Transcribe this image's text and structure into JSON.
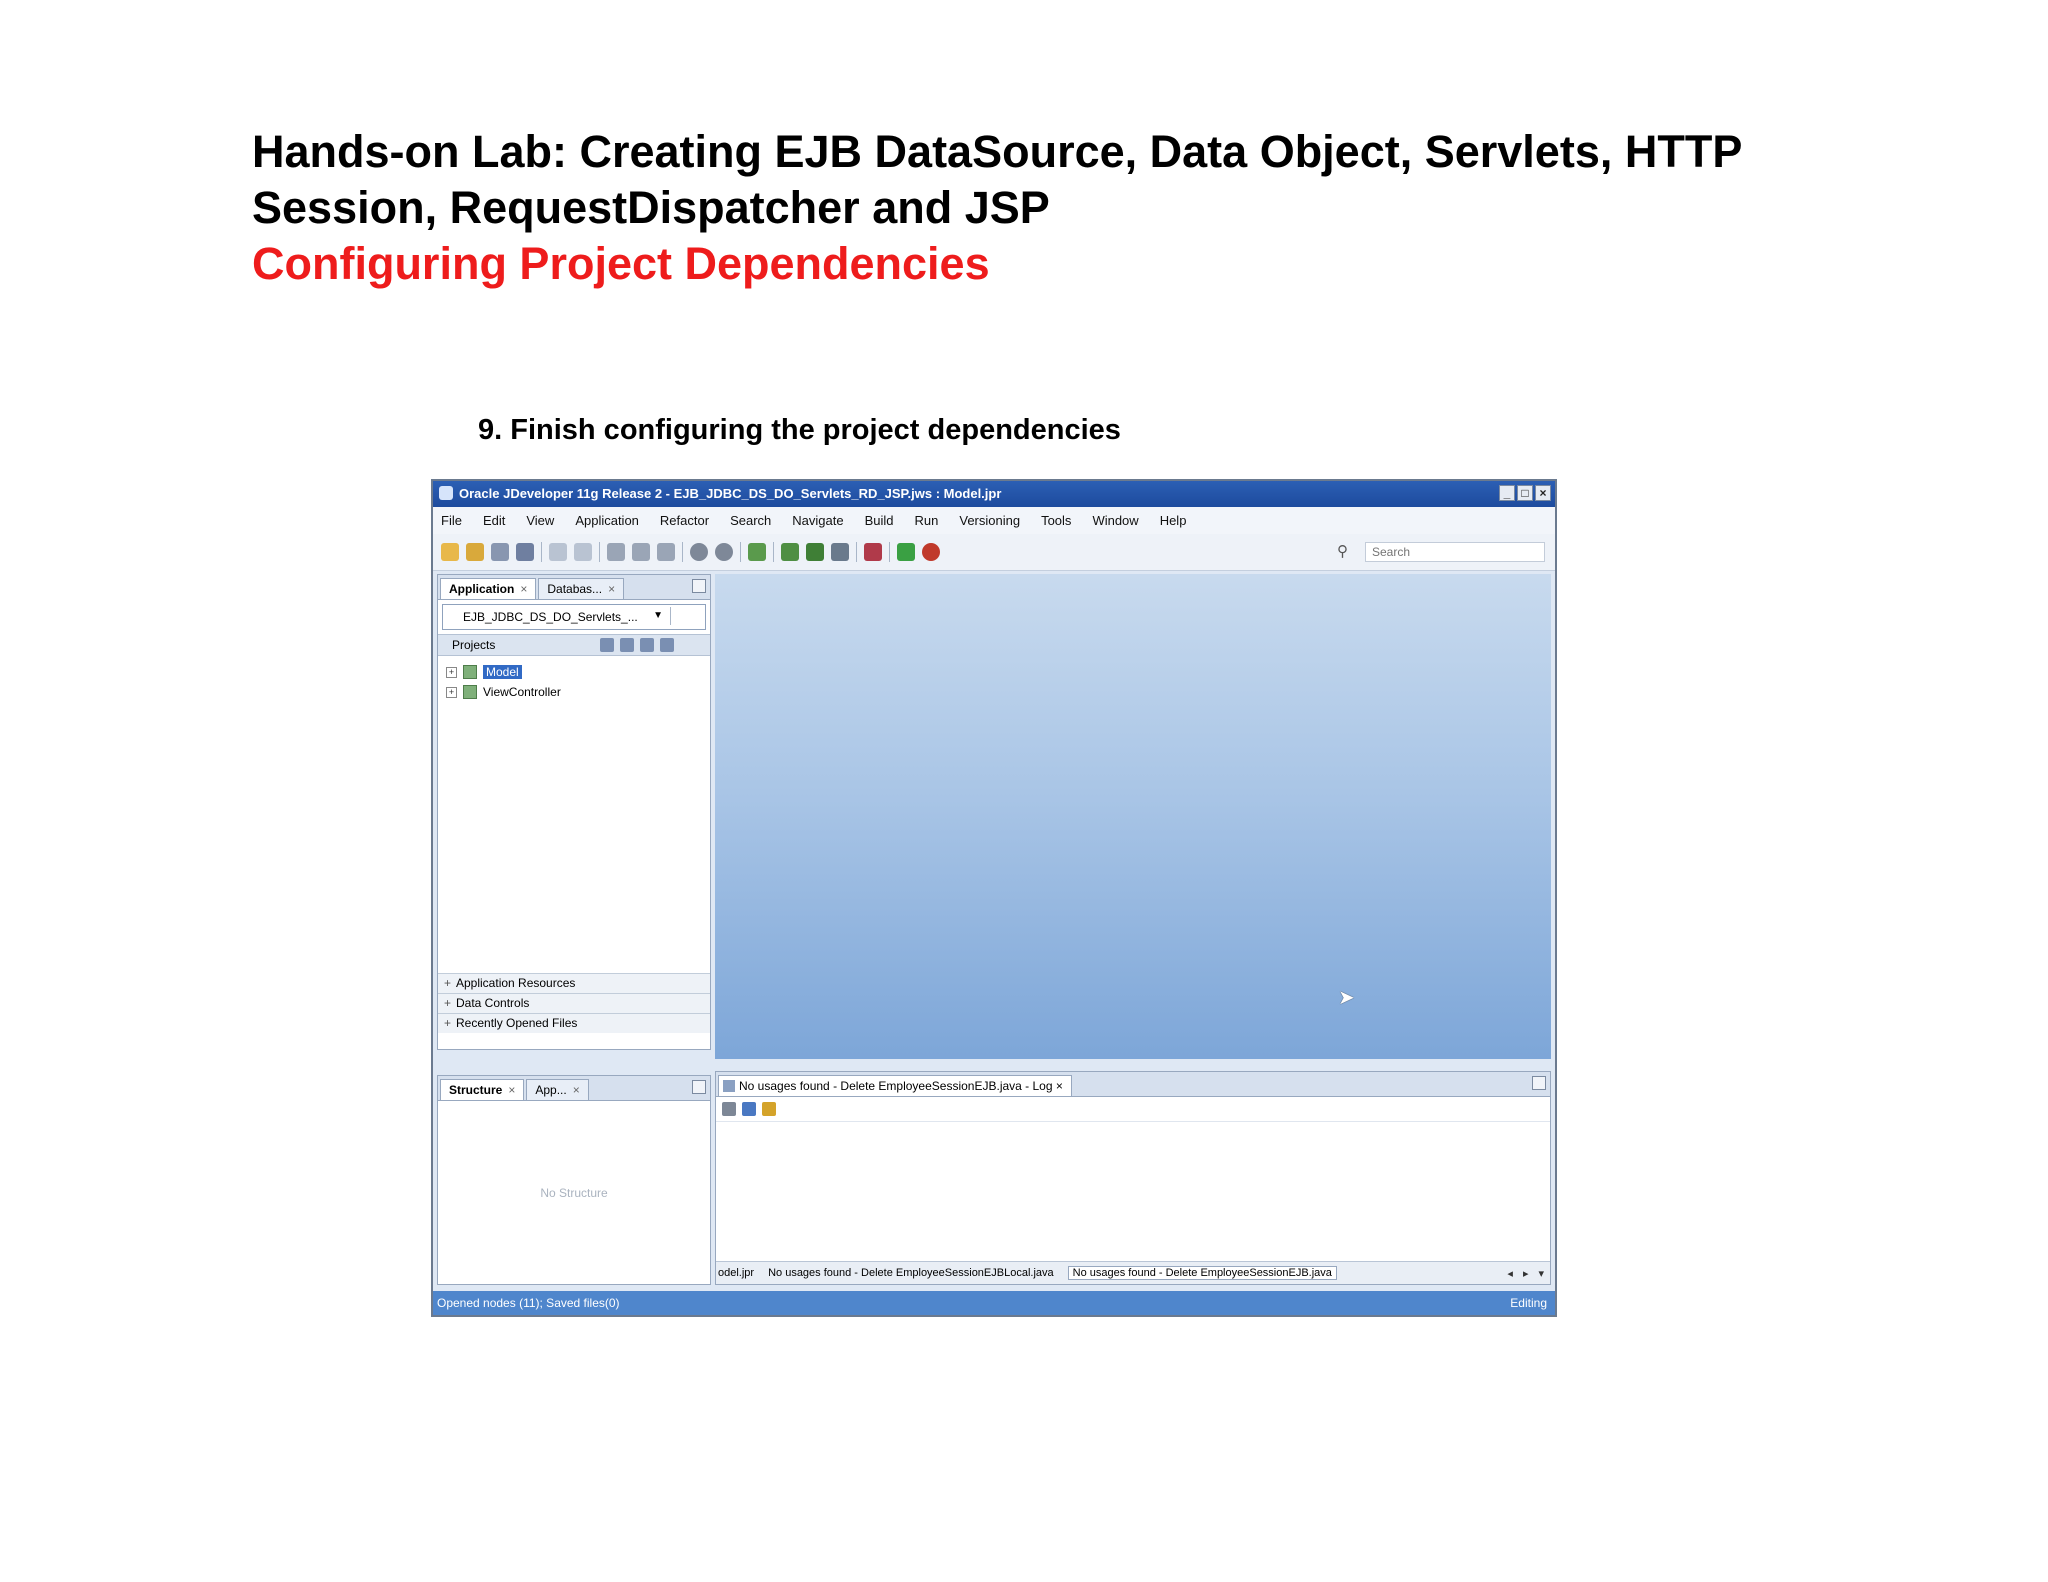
{
  "slide": {
    "title_line1": "Hands-on Lab: Creating EJB DataSource, Data Object, Servlets, HTTP Session, RequestDispatcher and JSP",
    "title_line2": "Configuring Project Dependencies",
    "step": "9. Finish configuring the project dependencies"
  },
  "window": {
    "title": "Oracle JDeveloper 11g Release 2 - EJB_JDBC_DS_DO_Servlets_RD_JSP.jws : Model.jpr",
    "controls": [
      "_",
      "□",
      "×"
    ]
  },
  "menu": [
    "File",
    "Edit",
    "View",
    "Application",
    "Refactor",
    "Search",
    "Navigate",
    "Build",
    "Run",
    "Versioning",
    "Tools",
    "Window",
    "Help"
  ],
  "search": {
    "placeholder": "Search"
  },
  "application_navigator": {
    "tabs": [
      "Application",
      "Databas..."
    ],
    "selected_app": "EJB_JDBC_DS_DO_Servlets_...",
    "projects_label": "Projects",
    "projects": [
      "Model",
      "ViewController"
    ],
    "accordions": [
      "Application Resources",
      "Data Controls",
      "Recently Opened Files"
    ]
  },
  "structure": {
    "tabs": [
      "Structure",
      "App..."
    ],
    "empty_text": "No Structure"
  },
  "log": {
    "tab_label": "No usages found - Delete EmployeeSessionEJB.java - Log",
    "bottom_tabs": [
      "odel.jpr",
      "No usages found - Delete EmployeeSessionEJBLocal.java",
      "No usages found - Delete EmployeeSessionEJB.java"
    ]
  },
  "status": {
    "left": "Opened nodes (11); Saved files(0)",
    "right": "Editing"
  },
  "colors": {
    "title_red": "#ee1c1c",
    "titlebar_blue": "#2c5fb4",
    "statusbar_blue": "#4f86cc"
  }
}
